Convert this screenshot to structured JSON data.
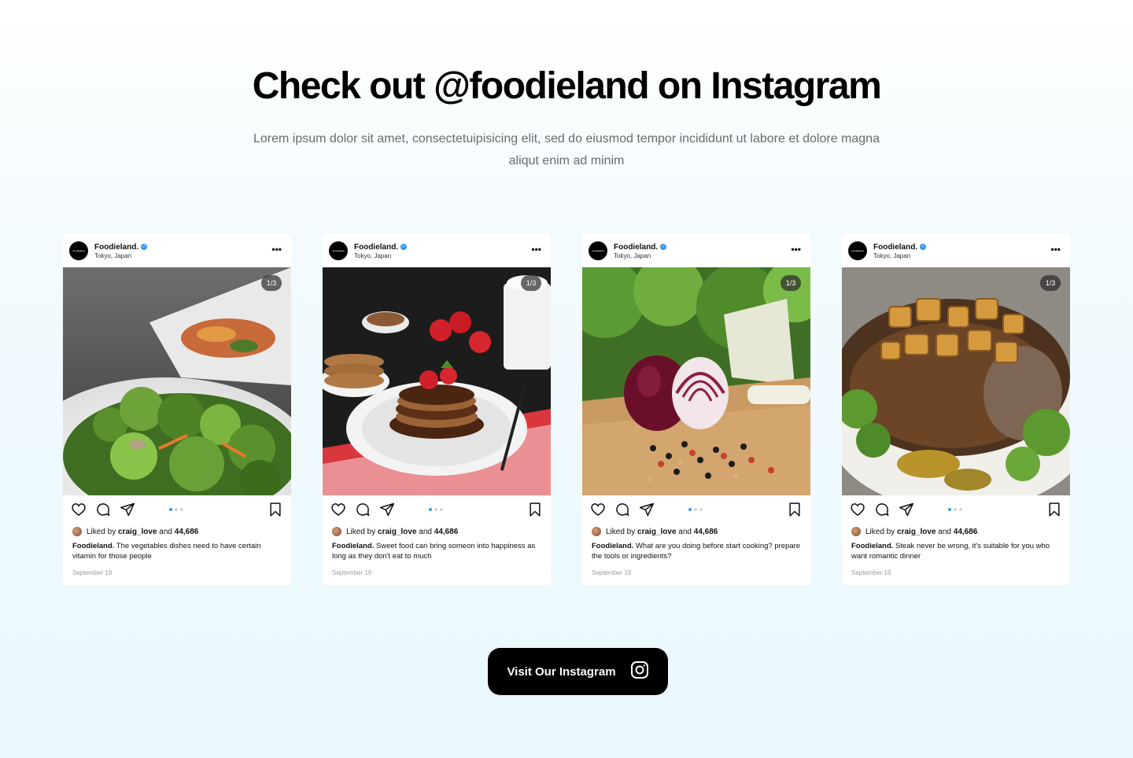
{
  "section": {
    "title": "Check out @foodieland on Instagram",
    "subtitle": "Lorem ipsum dolor sit amet, consectetuipisicing elit, sed do eiusmod tempor incididunt ut labore et dolore magna aliqut enim ad minim"
  },
  "posts": [
    {
      "avatar_text": "Foodieland",
      "username": "Foodieland.",
      "location": "Tokyo, Japan",
      "counter": "1/3",
      "liked_prefix": "Liked by",
      "liked_user": "craig_love",
      "liked_and": "and",
      "liked_count": "44,686",
      "caption_user": "Foodieland.",
      "caption_text": "The vegetables dishes need to have certain vitamin for those people",
      "date": "September 19",
      "photo": "salad"
    },
    {
      "avatar_text": "Foodieland",
      "username": "Foodieland.",
      "location": "Tokyo, Japan",
      "counter": "1/3",
      "liked_prefix": "Liked by",
      "liked_user": "craig_love",
      "liked_and": "and",
      "liked_count": "44,686",
      "caption_user": "Foodieland.",
      "caption_text": "Sweet food can bring someon into happiness as long as they don't eat to much",
      "date": "September 19",
      "photo": "pancakes"
    },
    {
      "avatar_text": "Foodieland",
      "username": "Foodieland.",
      "location": "Tokyo, Japan",
      "counter": "1/3",
      "liked_prefix": "Liked by",
      "liked_user": "craig_love",
      "liked_and": "and",
      "liked_count": "44,686",
      "caption_user": "Foodieland.",
      "caption_text": "What are you doing before start cooking? prepare the  tools or ingredients?",
      "date": "September 19",
      "photo": "onion"
    },
    {
      "avatar_text": "Foodieland",
      "username": "Foodieland.",
      "location": "Tokyo, Japan",
      "counter": "1/3",
      "liked_prefix": "Liked by",
      "liked_user": "craig_love",
      "liked_and": "and",
      "liked_count": "44,686",
      "caption_user": "Foodieland.",
      "caption_text": "Steak never be wrong, it's suitable for you who want romantic dinner",
      "date": "September 19",
      "photo": "steak"
    }
  ],
  "carousel": {
    "active_index": 0,
    "total": 3
  },
  "cta": {
    "label": "Visit Our Instagram",
    "icon": "instagram-icon"
  },
  "colors": {
    "verified": "#3897f0",
    "dot_active": "#3897f0",
    "dot_inactive": "#cfd5dd",
    "cta_bg": "#000000"
  }
}
